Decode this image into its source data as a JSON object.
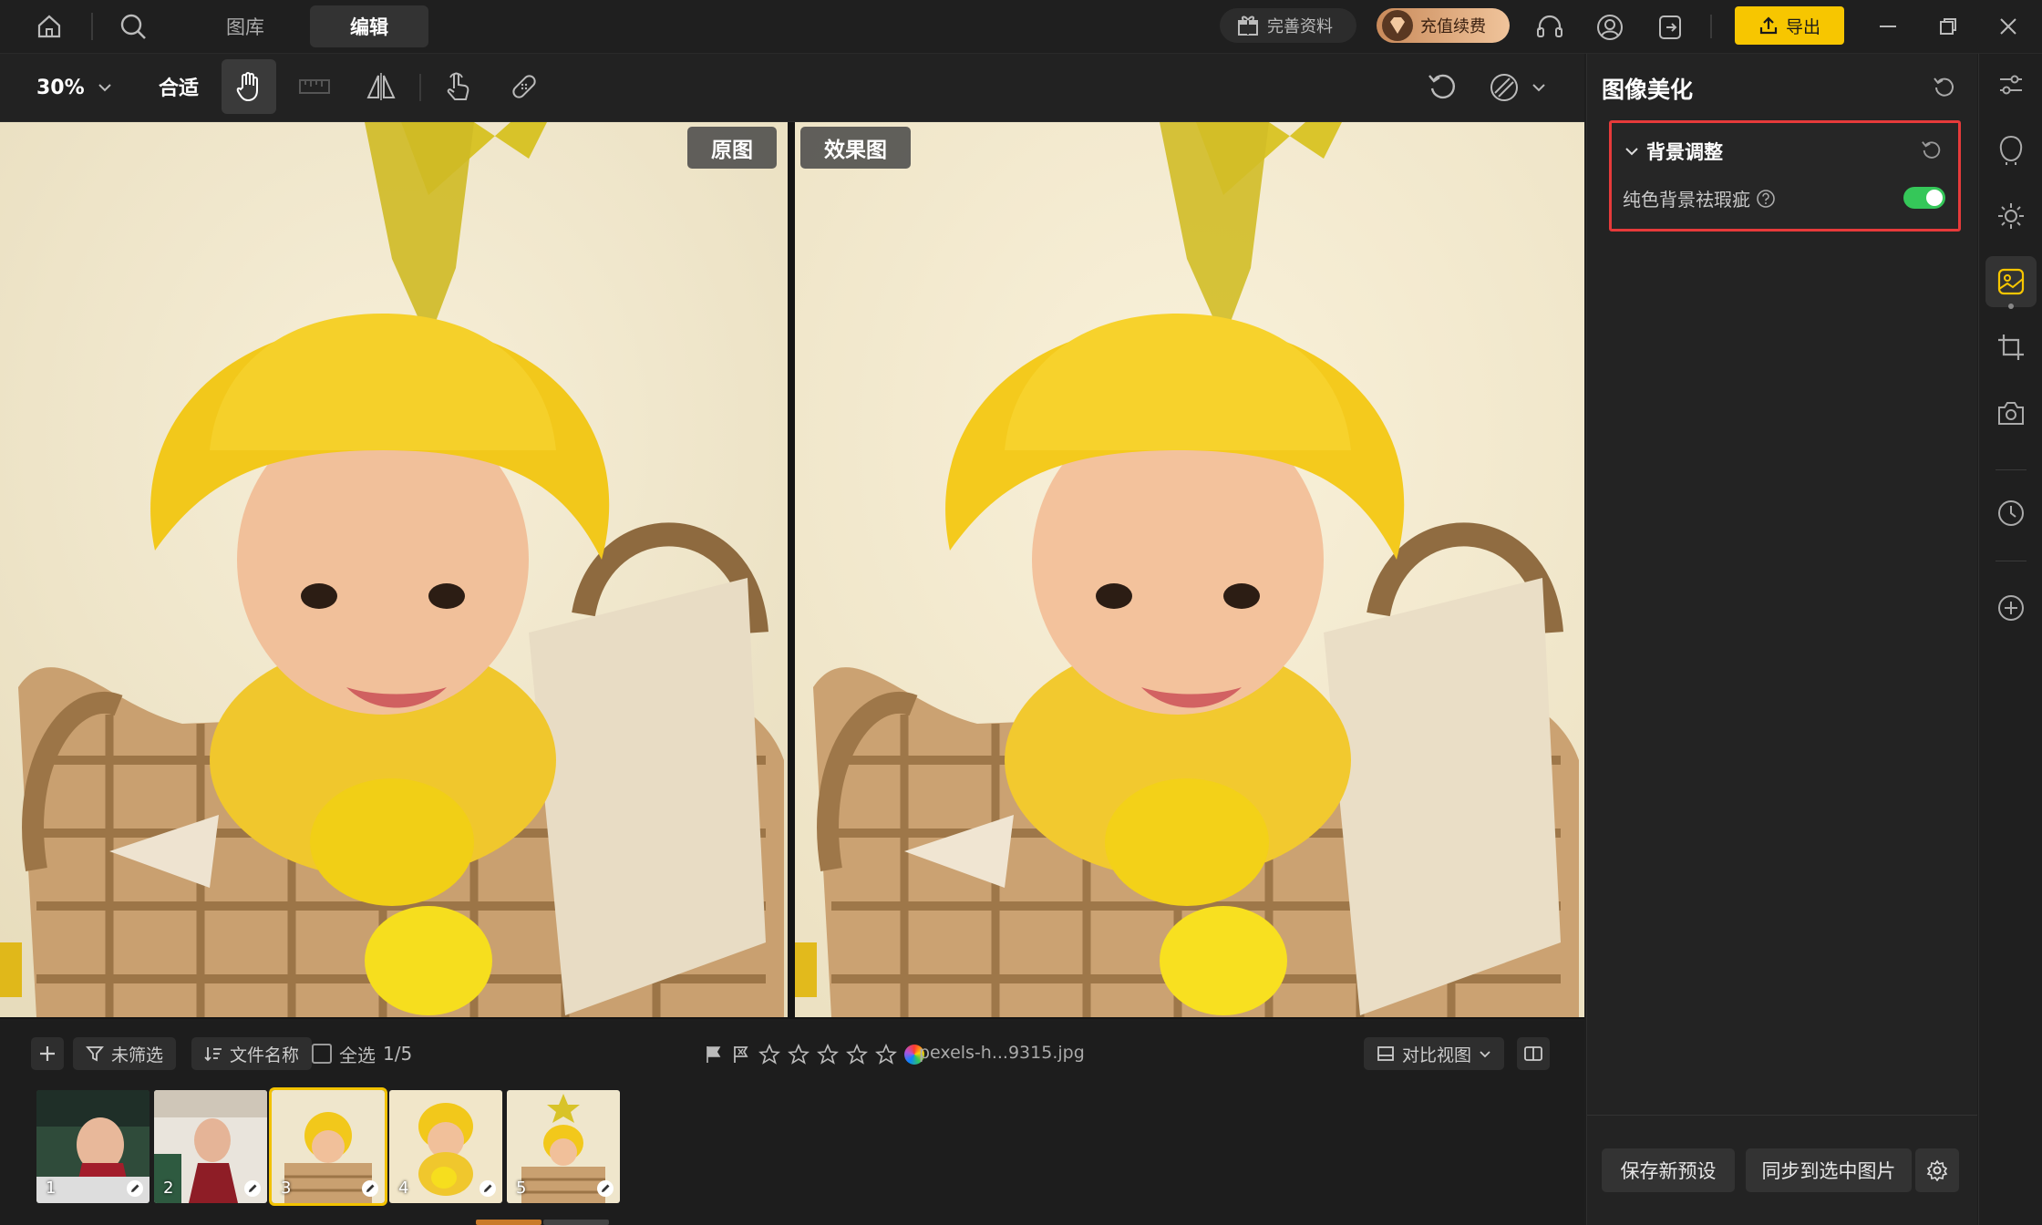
{
  "topbar": {
    "tabs": [
      {
        "label": "图库"
      },
      {
        "label": "编辑"
      }
    ],
    "complete_profile": "完善资料",
    "recharge": "充值续费",
    "export": "导出"
  },
  "toolbar": {
    "zoom": "30%",
    "fit": "合适"
  },
  "canvas": {
    "original_label": "原图",
    "result_label": "效果图"
  },
  "filmstrip": {
    "unfiltered": "未筛选",
    "sort_by": "文件名称",
    "select_all": "全选",
    "selection_count": "1/5",
    "filename": "pexels-h...9315.jpg",
    "compare_view": "对比视图",
    "thumbs": [
      "1",
      "2",
      "3",
      "4",
      "5"
    ]
  },
  "panel": {
    "title": "图像美化",
    "section_title": "背景调整",
    "option_label": "纯色背景祛瑕疵",
    "toggle_on": true,
    "save_preset": "保存新预设",
    "sync_to_selected": "同步到选中图片"
  },
  "colors": {
    "accent": "#f7c600",
    "toggle": "#35c759",
    "highlight_border": "#e63a3a"
  }
}
